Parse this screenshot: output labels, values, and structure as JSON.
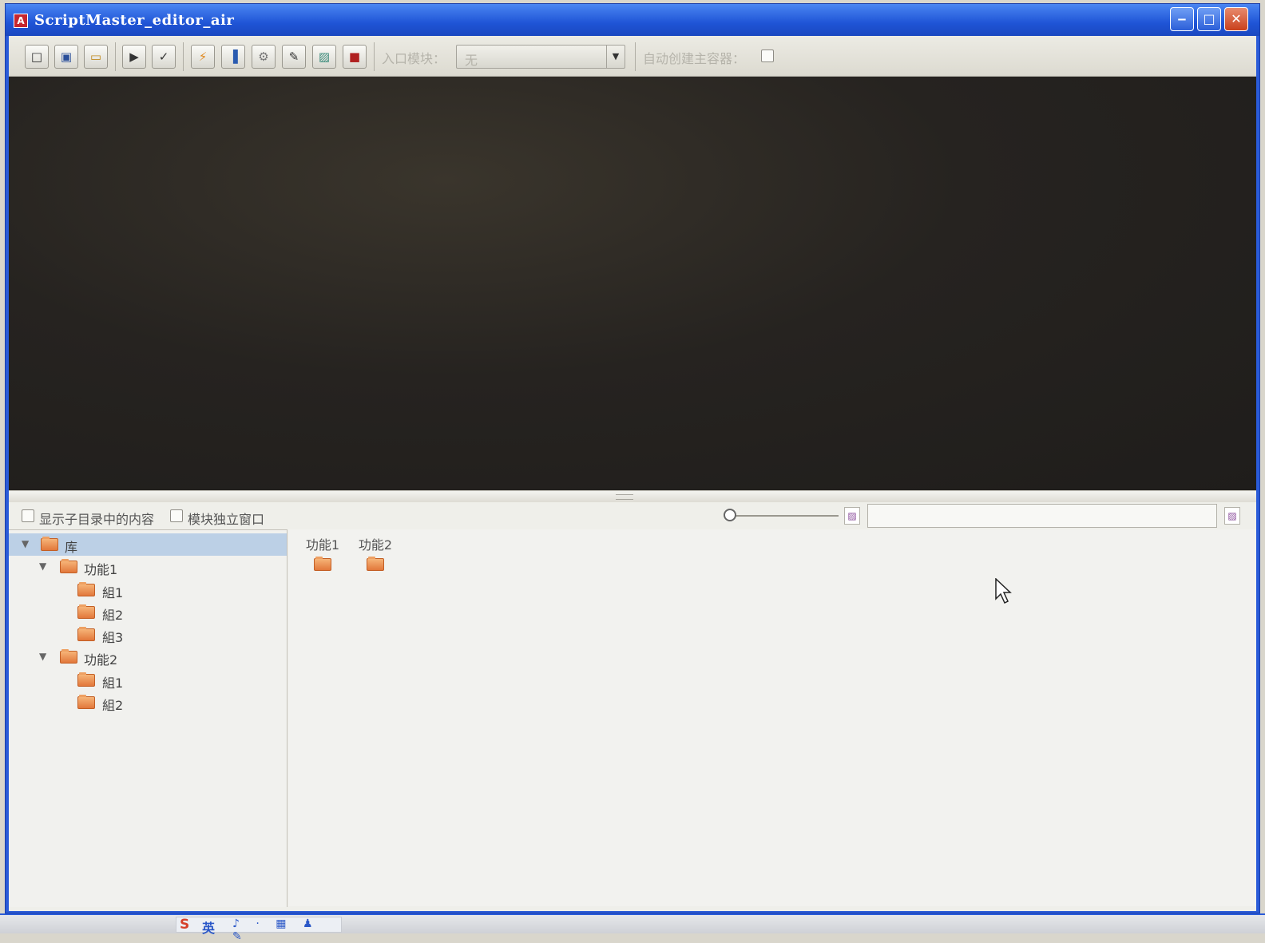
{
  "window": {
    "title": "ScriptMaster_editor_air",
    "app_icon": "script-master-icon",
    "controls": {
      "minimize": "‒",
      "maximize": "□",
      "close": "✕"
    }
  },
  "toolbar": {
    "buttons": [
      {
        "icon": "new-file-icon",
        "glyph": "□"
      },
      {
        "icon": "save-icon",
        "glyph": "▣"
      },
      {
        "icon": "open-folder-icon",
        "glyph": "▭"
      },
      {
        "icon": "run-icon",
        "glyph": "▶"
      },
      {
        "icon": "check-icon",
        "glyph": "✓"
      },
      {
        "icon": "lightning-icon",
        "glyph": "⚡"
      },
      {
        "icon": "columns-icon",
        "glyph": "▐"
      },
      {
        "icon": "gear-icon",
        "glyph": "⚙"
      },
      {
        "icon": "edit-image-icon",
        "glyph": "✎"
      },
      {
        "icon": "image-icon",
        "glyph": "▨"
      },
      {
        "icon": "red-flag-icon",
        "glyph": "■"
      }
    ],
    "entry_module_label": "入口模块：",
    "entry_module_value": "无",
    "auto_create_label": "自动创建主容器：",
    "auto_create_checked": false
  },
  "options": {
    "show_subdir_label": "显示子目录中的内容",
    "show_subdir_checked": false,
    "module_window_label": "模块独立窗口",
    "module_window_checked": false,
    "slider_value": 0,
    "search_value": ""
  },
  "tree": {
    "items": [
      {
        "label": "库",
        "level": 0,
        "expanded": true,
        "selected": true
      },
      {
        "label": "功能1",
        "level": 1,
        "expanded": true
      },
      {
        "label": "組1",
        "level": 2
      },
      {
        "label": "組2",
        "level": 2
      },
      {
        "label": "組3",
        "level": 2
      },
      {
        "label": "功能2",
        "level": 1,
        "expanded": true
      },
      {
        "label": "組1",
        "level": 2
      },
      {
        "label": "組2",
        "level": 2
      }
    ]
  },
  "content": {
    "items": [
      {
        "label": "功能1"
      },
      {
        "label": "功能2"
      }
    ]
  },
  "taskbar": {
    "ime_logo": "S",
    "ime_mode": "英",
    "ime_tray": "♪ · ▦ ♟ ✎"
  },
  "colors": {
    "titlebar": "#1f54d6",
    "folder": "#e2783b",
    "selection": "#bcd0e6",
    "canvas": "#262320"
  }
}
